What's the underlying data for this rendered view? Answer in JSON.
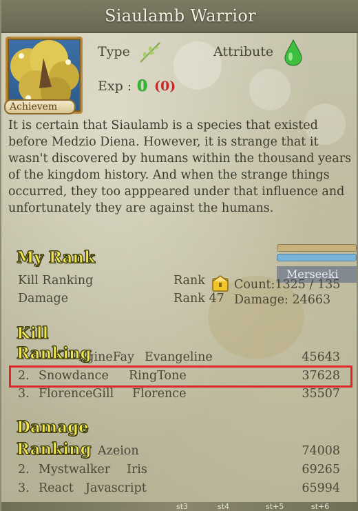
{
  "window": {
    "title": "Siaulamb Warrior"
  },
  "header": {
    "type_label": "Type",
    "attribute_label": "Attribute",
    "exp_label": "Exp :",
    "exp_value": "0",
    "exp_bonus": "(0)",
    "achievement_label": "Achievem",
    "type_icon": "leaf-icon",
    "attribute_icon": "green-drop-icon"
  },
  "description": "It is certain that Siaulamb is a species that existed before Medzio Diena. However, it is strange that it wasn't discovered by humans within the thousand years of the kingdom history. And when the strange things occurred, they too apppeared under that influence and unfortunately they are against the humans.",
  "my_rank": {
    "heading": "My Rank",
    "rows": [
      {
        "label": "Kill Ranking",
        "rank": "Rank",
        "stat": "Count:1325 / 135"
      },
      {
        "label": "Damage",
        "rank": "Rank 47",
        "stat": "Damage: 24663"
      }
    ],
    "overlay_tag": "Merseeki"
  },
  "kill_ranking": {
    "heading_line1": "Kill",
    "heading_line2": "Ranking",
    "rows": [
      {
        "num": "",
        "name": "ngineFay",
        "team": "Evangeline",
        "value": "45643"
      },
      {
        "num": "2.",
        "name": "Snowdance",
        "team": "RingTone",
        "value": "37628"
      },
      {
        "num": "3.",
        "name": "FlorenceGill",
        "team": "Florence",
        "value": "35507"
      }
    ]
  },
  "damage_ranking": {
    "heading_line1": "Damage",
    "heading_line2": "Ranking",
    "rows": [
      {
        "num": "",
        "name": "",
        "team": "Azeion",
        "value": "74008"
      },
      {
        "num": "2.",
        "name": "Mystwalker",
        "team": "Iris",
        "value": "69265"
      },
      {
        "num": "3.",
        "name": "React",
        "team": "Javascript",
        "value": "65994"
      }
    ]
  },
  "bottom_strip": [
    "st3",
    "st4",
    "st+5",
    "st+6"
  ],
  "colors": {
    "highlight": "#e0262b",
    "heading_yellow": "#f1e64a",
    "exp_green": "#2db82d",
    "exp_red": "#c42a2a"
  }
}
